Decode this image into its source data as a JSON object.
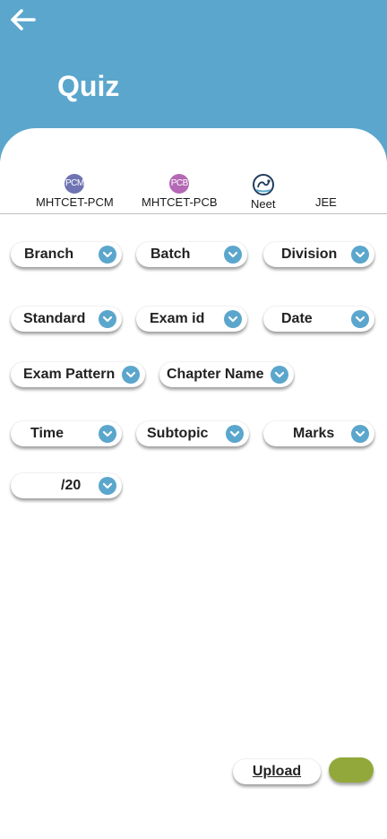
{
  "header": {
    "title": "Quiz",
    "color": "#5ba6cc"
  },
  "exam_tabs": [
    {
      "badge": "PCM",
      "label": "MHTCET-PCM",
      "color": "#6f73b2"
    },
    {
      "badge": "PCB",
      "label": "MHTCET-PCB",
      "color": "#b468b5"
    },
    {
      "icon": "stethoscope-icon",
      "label": "Neet"
    },
    {
      "label": "JEE"
    }
  ],
  "filters": {
    "branch": "Branch",
    "batch": "Batch",
    "division": "Division",
    "standard": "Standard",
    "exam_id": "Exam id",
    "date": "Date",
    "exam_pattern": "Exam Pattern",
    "chapter_name": "Chapter Name",
    "time": "Time",
    "subtopic": "Subtopic",
    "marks": "Marks",
    "out_of": "/20"
  },
  "actions": {
    "upload": "Upload",
    "submit_color": "#93a83a"
  }
}
